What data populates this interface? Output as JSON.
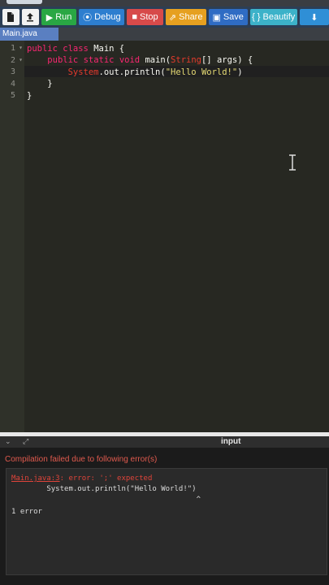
{
  "toolbar": {
    "run_label": "Run",
    "debug_label": "Debug",
    "stop_label": "Stop",
    "share_label": "Share",
    "save_label": "Save",
    "beautify_label": "{ } Beautify",
    "run_icon": "play-icon",
    "debug_icon": "bug-icon",
    "stop_icon": "stop-icon",
    "share_icon": "share-icon",
    "save_icon": "floppy-disk-icon",
    "download_icon": "download-icon"
  },
  "file": {
    "tab_name": "Main.java"
  },
  "editor": {
    "lines": [
      {
        "num": "1",
        "fold": "▾",
        "tokens": [
          [
            "kw",
            "public "
          ],
          [
            "kw",
            "class "
          ],
          [
            "plain",
            "Main {"
          ]
        ]
      },
      {
        "num": "2",
        "fold": "▾",
        "tokens": [
          [
            "plain",
            "    "
          ],
          [
            "kw",
            "public "
          ],
          [
            "kw",
            "static "
          ],
          [
            "kw",
            "void "
          ],
          [
            "plain",
            "main("
          ],
          [
            "err",
            "String"
          ],
          [
            "plain",
            "[] args) {"
          ]
        ]
      },
      {
        "num": "3",
        "fold": "",
        "tokens": [
          [
            "plain",
            "        "
          ],
          [
            "err",
            "System"
          ],
          [
            "plain",
            ".out.println("
          ],
          [
            "str",
            "\"Hello World!\""
          ],
          [
            "plain",
            ")"
          ]
        ]
      },
      {
        "num": "4",
        "fold": "",
        "tokens": [
          [
            "plain",
            "    }"
          ]
        ]
      },
      {
        "num": "5",
        "fold": "",
        "tokens": [
          [
            "plain",
            "}"
          ]
        ]
      }
    ]
  },
  "io_panel": {
    "label": "input",
    "toggle_icon": "chevron-down-icon",
    "expand_icon": "expand-icon"
  },
  "output": {
    "fail_message": "Compilation failed due to following error(s)",
    "console": {
      "error_link": "Main.java:3",
      "error_text": ": error: ';' expected",
      "source_line": "        System.out.println(\"Hello World!\")",
      "caret_line": "                                          ^",
      "summary": "1 error"
    }
  },
  "colors": {
    "run": "#29a744",
    "debug": "#2d7ecf",
    "stop": "#d74a4a",
    "share": "#e6a020",
    "save": "#2f6cc4",
    "beautify": "#3cb2c9"
  }
}
